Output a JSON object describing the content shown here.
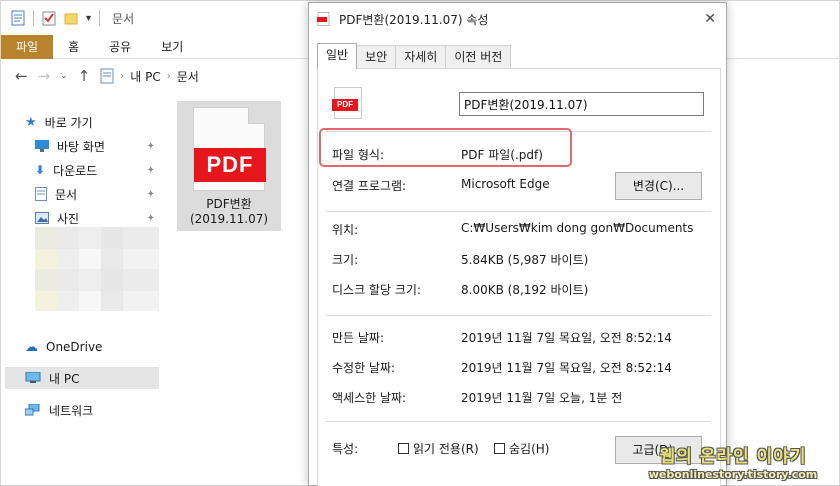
{
  "explorer": {
    "title": "문서",
    "ribbon_tabs": [
      "파일",
      "홈",
      "공유",
      "보기"
    ],
    "breadcrumb": [
      "내 PC",
      "문서"
    ],
    "sidebar": {
      "quick_access": "바로 가기",
      "items": [
        "바탕 화면",
        "다운로드",
        "문서",
        "사진"
      ],
      "onedrive": "OneDrive",
      "this_pc": "내 PC",
      "network": "네트워크"
    },
    "file": {
      "badge": "PDF",
      "name_line1": "PDF변환",
      "name_line2": "(2019.11.07)"
    }
  },
  "dialog": {
    "title": "PDF변환(2019.11.07) 속성",
    "tabs": [
      "일반",
      "보안",
      "자세히",
      "이전 버전"
    ],
    "icon_badge": "PDF",
    "filename": "PDF변환(2019.11.07)",
    "rows": {
      "type_label": "파일 형식:",
      "type_value": "PDF 파일(.pdf)",
      "app_label": "연결 프로그램:",
      "app_value": "Microsoft Edge",
      "change_button": "변경(C)...",
      "location_label": "위치:",
      "location_value": "C:₩Users₩kim dong gon₩Documents",
      "size_label": "크기:",
      "size_value": "5.84KB (5,987 바이트)",
      "disk_label": "디스크 할당 크기:",
      "disk_value": "8.00KB (8,192 바이트)",
      "created_label": "만든 날짜:",
      "created_value": "2019년 11월 7일 목요일, 오전 8:52:14",
      "modified_label": "수정한 날짜:",
      "modified_value": "2019년 11월 7일 목요일, 오전 8:52:14",
      "accessed_label": "액세스한 날짜:",
      "accessed_value": "2019년 11월 7일 오늘, 1분 전",
      "attr_label": "특성:",
      "readonly_label": "읽기 전용(R)",
      "hidden_label": "숨김(H)",
      "advanced_button": "고급(D)..."
    }
  },
  "watermark": {
    "line1": "웹의 온라인 이야기",
    "line2": "webonlinestory.tistory.com"
  },
  "colors": {
    "pdf_red": "#e5161c",
    "file_tab": "#b7832b",
    "highlight": "#e06a6a"
  }
}
